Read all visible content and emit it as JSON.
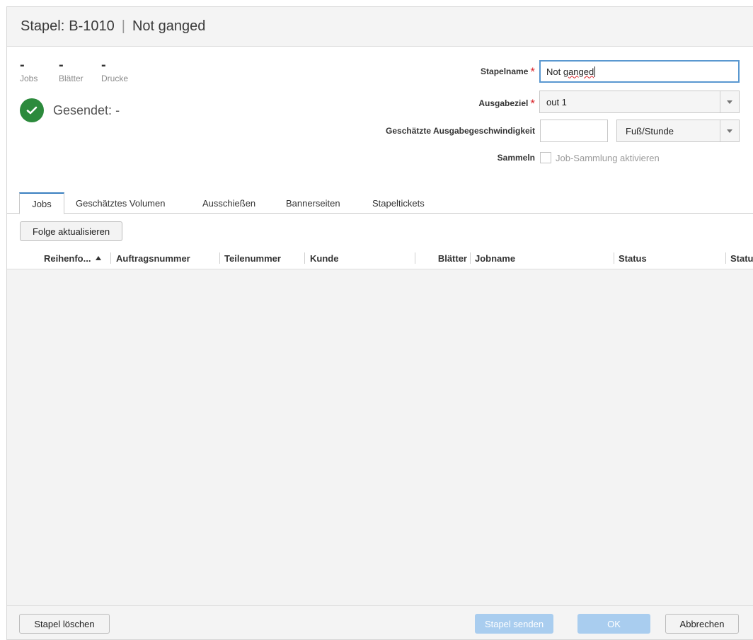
{
  "dialog": {
    "title_prefix": "Stapel:",
    "batch_id": "B-1010",
    "separator": "|",
    "batch_name": "Not ganged"
  },
  "stats": [
    {
      "value": "-",
      "label": "Jobs"
    },
    {
      "value": "-",
      "label": "Blätter"
    },
    {
      "value": "-",
      "label": "Drucke"
    }
  ],
  "sent": {
    "label": "Gesendet:",
    "value": "-",
    "icon": "check-circle-icon",
    "color": "#2c8a3c"
  },
  "form": {
    "name_label": "Stapelname",
    "name_value_a": "Not ",
    "name_value_b": "ganged",
    "required_mark": "*",
    "output_label": "Ausgabeziel",
    "output_value": "out 1",
    "speed_label": "Geschätzte Ausgabegeschwindigkeit",
    "speed_value": "",
    "speed_unit": "Fuß/Stunde",
    "collect_label": "Sammeln",
    "collect_checkbox_label": "Job-Sammlung aktivieren",
    "collect_checked": false
  },
  "tabs": [
    {
      "label": "Jobs",
      "active": true
    },
    {
      "label": "Geschätztes Volumen",
      "active": false
    },
    {
      "label": "Ausschießen",
      "active": false
    },
    {
      "label": "Bannerseiten",
      "active": false
    },
    {
      "label": "Stapeltickets",
      "active": false
    }
  ],
  "toolbar": {
    "update_order_label": "Folge aktualisieren"
  },
  "table": {
    "columns": [
      "Reihenfo...",
      "Auftragsnummer",
      "Teilenummer",
      "Kunde",
      "Blätter",
      "Jobname",
      "Status",
      "Statu"
    ],
    "sort_column": "Reihenfo...",
    "sort_direction": "ascending",
    "rows": []
  },
  "footer": {
    "delete_label": "Stapel löschen",
    "send_label": "Stapel senden",
    "ok_label": "OK",
    "cancel_label": "Abbrechen"
  },
  "colors": {
    "accent": "#3a7fc0",
    "required": "#d9262c",
    "primary_disabled": "#a9cdef"
  }
}
